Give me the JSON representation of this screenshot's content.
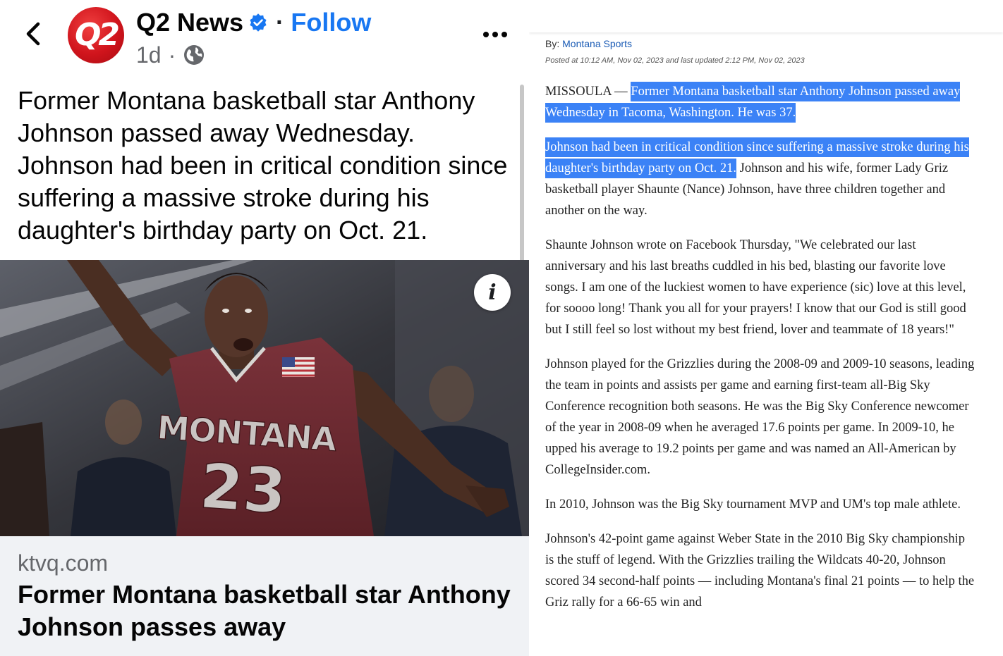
{
  "post": {
    "page_name": "Q2 News",
    "avatar_text": "Q2",
    "separator": "·",
    "follow_label": "Follow",
    "time": "1d",
    "meta_separator": "·",
    "audience_icon": "globe-icon",
    "verified_icon": "verified-badge-icon",
    "more_icon": "more-options-icon",
    "back_icon": "back-chevron-icon",
    "text": "Former Montana basketball star Anthony Johnson passed away Wednesday. Johnson had been in critical condition since suffering a massive stroke during his daughter's birthday party on Oct. 21.",
    "photo": {
      "jersey_name": "MONTANA",
      "jersey_number": "23",
      "info_icon": "i"
    },
    "link": {
      "domain": "ktvq.com",
      "title": "Former Montana basketball star Anthony Johnson passes away"
    }
  },
  "article": {
    "by_label": "By:",
    "author": "Montana Sports",
    "posted": "Posted at 10:12 AM, Nov 02, 2023 and last updated 2:12 PM, Nov 02, 2023",
    "p1_dateline": "MISSOULA — ",
    "p1_highlight": "Former Montana basketball star Anthony Johnson passed away Wednesday in Tacoma, Washington. He was 37.",
    "p2_highlight": "Johnson had been in critical condition since suffering a massive stroke during his daughter's birthday party on Oct. 21.",
    "p2_rest": " Johnson and his wife, former Lady Griz basketball player Shaunte (Nance) Johnson, have three children together and another on the way.",
    "p3": "Shaunte Johnson wrote on Facebook Thursday, \"We celebrated our last anniversary and his last breaths cuddled in his bed, blasting our favorite love songs. I am one of the luckiest women to have experience (sic) love at this level, for soooo long! Thank you all for your prayers! I know that our God is still good but I still feel so lost without my best friend, lover and teammate of 18 years!\"",
    "p4": "Johnson played for the Grizzlies during the 2008-09 and 2009-10 seasons, leading the team in points and assists per game and earning first-team all-Big Sky Conference recognition both seasons. He was the Big Sky Conference newcomer of the year in 2008-09 when he averaged 17.6 points per game. In 2009-10, he upped his average to 19.2 points per game and was named an All-American by CollegeInsider.com.",
    "p5": "In 2010, Johnson was the Big Sky tournament MVP and UM's top male athlete.",
    "p6": "Johnson's 42-point game against Weber State in the 2010 Big Sky championship is the stuff of legend. With the Grizzlies trailing the Wildcats 40-20, Johnson scored 34 second-half points — including Montana's final 21 points — to help the Griz rally for a 66-65 win and"
  },
  "colors": {
    "follow_blue": "#1877f2",
    "highlight_blue": "#3b82f6",
    "link_card_bg": "#f0f2f5",
    "jersey_maroon": "#6e2a30",
    "brand_red": "#d0141c"
  }
}
